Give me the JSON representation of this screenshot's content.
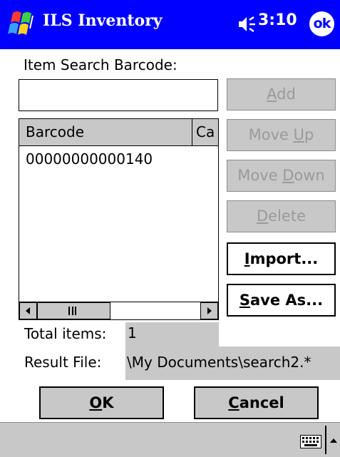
{
  "titlebar": {
    "title": "ILS Inventory",
    "time": "3:10",
    "ok_label": "ok",
    "start_icon": "windows-flag-icon",
    "speaker_icon": "speaker-icon",
    "background": "#0000ff"
  },
  "search": {
    "label": "Item Search Barcode:",
    "value": "",
    "placeholder": ""
  },
  "buttons": {
    "add": {
      "pre": "",
      "key": "A",
      "post": "dd",
      "enabled": false
    },
    "move_up": {
      "pre": "Move ",
      "key": "U",
      "post": "p",
      "enabled": false
    },
    "move_down": {
      "pre": "Move ",
      "key": "D",
      "post": "own",
      "enabled": false
    },
    "delete": {
      "pre": "",
      "key": "D",
      "post": "elete",
      "enabled": false
    },
    "import": {
      "pre": "",
      "key": "I",
      "post": "mport...",
      "enabled": true
    },
    "save_as": {
      "pre": "",
      "key": "S",
      "post": "ave As...",
      "enabled": true
    }
  },
  "list": {
    "columns": [
      "Barcode",
      "Ca"
    ],
    "rows": [
      "00000000000140"
    ]
  },
  "totals": {
    "label": "Total items:",
    "value": "1"
  },
  "result": {
    "label": "Result File:",
    "value": "\\My Documents\\search2.*"
  },
  "dialog": {
    "ok": {
      "key": "O",
      "post": "K"
    },
    "cancel": {
      "key": "C",
      "post": "ancel"
    }
  },
  "bottombar": {
    "keyboard_icon": "keyboard-icon",
    "sip_arrow_icon": "sip-up-arrow-icon"
  },
  "colors": {
    "titlebar": "#0000ff",
    "disabled_bg": "#c8c8c8",
    "disabled_text": "#9a9a9a"
  }
}
